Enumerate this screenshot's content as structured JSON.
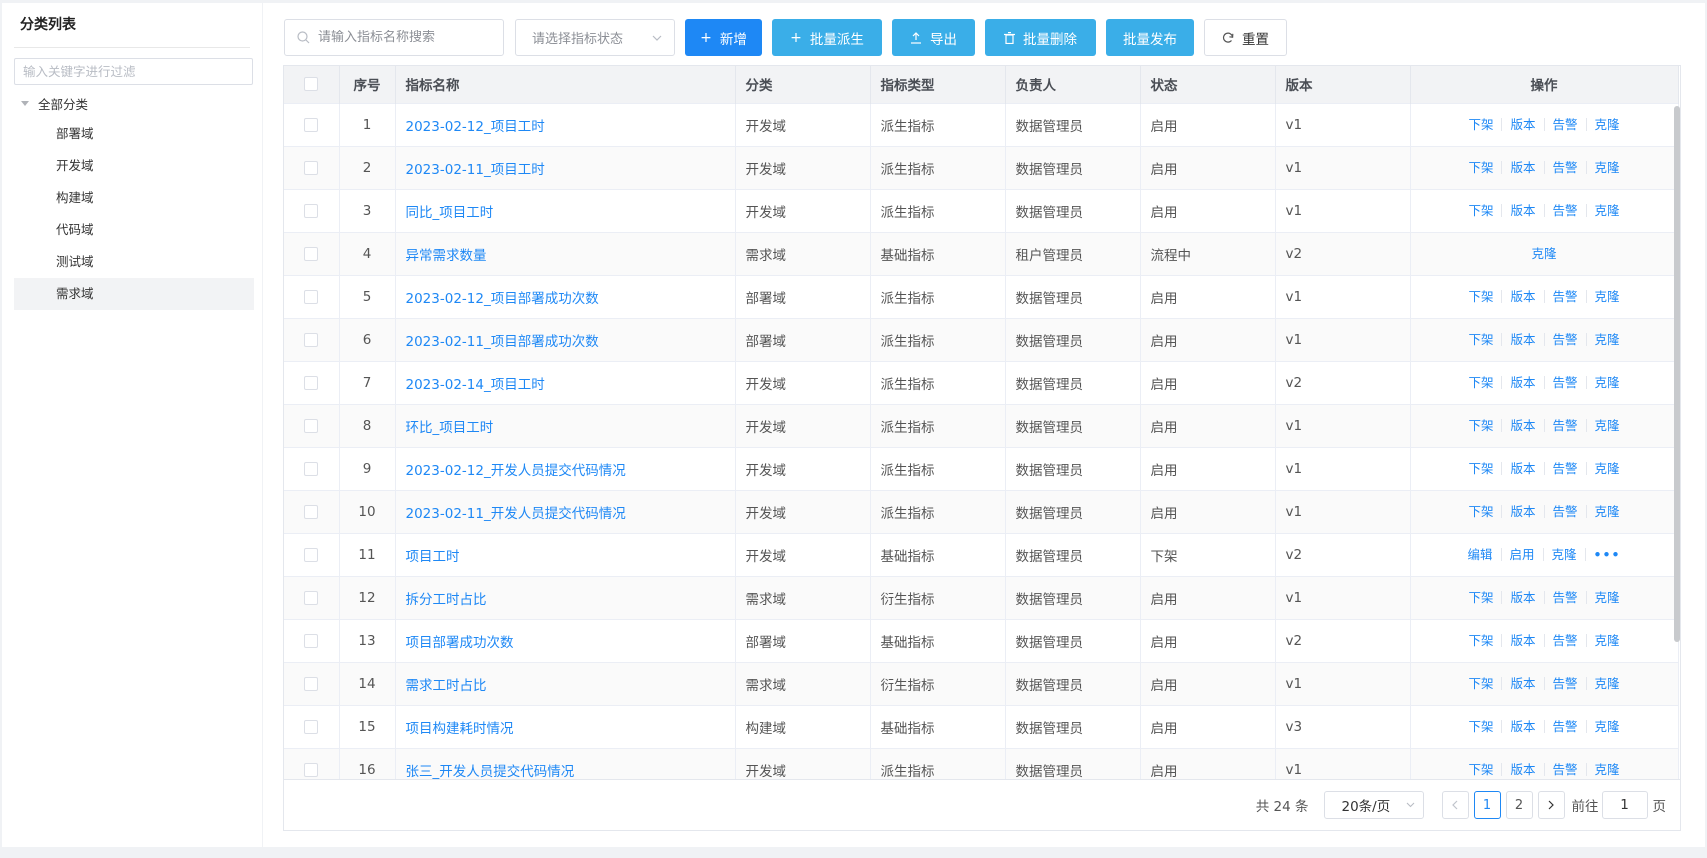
{
  "sidebar": {
    "title": "分类列表",
    "filter_placeholder": "输入关键字进行过滤",
    "root_label": "全部分类",
    "items": [
      {
        "label": "部署域"
      },
      {
        "label": "开发域"
      },
      {
        "label": "构建域"
      },
      {
        "label": "代码域"
      },
      {
        "label": "测试域"
      },
      {
        "label": "需求域"
      }
    ],
    "active_item": "需求域"
  },
  "toolbar": {
    "search_placeholder": "请输入指标名称搜索",
    "status_placeholder": "请选择指标状态",
    "add_label": "新增",
    "batch_derive_label": "批量派生",
    "export_label": "导出",
    "batch_delete_label": "批量删除",
    "batch_publish_label": "批量发布",
    "reset_label": "重置"
  },
  "table": {
    "columns": [
      "序号",
      "指标名称",
      "分类",
      "指标类型",
      "负责人",
      "状态",
      "版本",
      "操作"
    ],
    "rows": [
      {
        "no": "1",
        "name": "2023-02-12_项目工时",
        "category": "开发域",
        "type": "派生指标",
        "owner": "数据管理员",
        "status": "启用",
        "version": "v1",
        "ops": [
          "下架",
          "版本",
          "告警",
          "克隆"
        ]
      },
      {
        "no": "2",
        "name": "2023-02-11_项目工时",
        "category": "开发域",
        "type": "派生指标",
        "owner": "数据管理员",
        "status": "启用",
        "version": "v1",
        "ops": [
          "下架",
          "版本",
          "告警",
          "克隆"
        ]
      },
      {
        "no": "3",
        "name": "同比_项目工时",
        "category": "开发域",
        "type": "派生指标",
        "owner": "数据管理员",
        "status": "启用",
        "version": "v1",
        "ops": [
          "下架",
          "版本",
          "告警",
          "克隆"
        ]
      },
      {
        "no": "4",
        "name": "异常需求数量",
        "category": "需求域",
        "type": "基础指标",
        "owner": "租户管理员",
        "status": "流程中",
        "version": "v2",
        "ops": [
          "克隆"
        ]
      },
      {
        "no": "5",
        "name": "2023-02-12_项目部署成功次数",
        "category": "部署域",
        "type": "派生指标",
        "owner": "数据管理员",
        "status": "启用",
        "version": "v1",
        "ops": [
          "下架",
          "版本",
          "告警",
          "克隆"
        ]
      },
      {
        "no": "6",
        "name": "2023-02-11_项目部署成功次数",
        "category": "部署域",
        "type": "派生指标",
        "owner": "数据管理员",
        "status": "启用",
        "version": "v1",
        "ops": [
          "下架",
          "版本",
          "告警",
          "克隆"
        ]
      },
      {
        "no": "7",
        "name": "2023-02-14_项目工时",
        "category": "开发域",
        "type": "派生指标",
        "owner": "数据管理员",
        "status": "启用",
        "version": "v2",
        "ops": [
          "下架",
          "版本",
          "告警",
          "克隆"
        ]
      },
      {
        "no": "8",
        "name": "环比_项目工时",
        "category": "开发域",
        "type": "派生指标",
        "owner": "数据管理员",
        "status": "启用",
        "version": "v1",
        "ops": [
          "下架",
          "版本",
          "告警",
          "克隆"
        ]
      },
      {
        "no": "9",
        "name": "2023-02-12_开发人员提交代码情况",
        "category": "开发域",
        "type": "派生指标",
        "owner": "数据管理员",
        "status": "启用",
        "version": "v1",
        "ops": [
          "下架",
          "版本",
          "告警",
          "克隆"
        ]
      },
      {
        "no": "10",
        "name": "2023-02-11_开发人员提交代码情况",
        "category": "开发域",
        "type": "派生指标",
        "owner": "数据管理员",
        "status": "启用",
        "version": "v1",
        "ops": [
          "下架",
          "版本",
          "告警",
          "克隆"
        ]
      },
      {
        "no": "11",
        "name": "项目工时",
        "category": "开发域",
        "type": "基础指标",
        "owner": "数据管理员",
        "status": "下架",
        "version": "v2",
        "ops": [
          "编辑",
          "启用",
          "克隆",
          "•••"
        ]
      },
      {
        "no": "12",
        "name": "拆分工时占比",
        "category": "需求域",
        "type": "衍生指标",
        "owner": "数据管理员",
        "status": "启用",
        "version": "v1",
        "ops": [
          "下架",
          "版本",
          "告警",
          "克隆"
        ]
      },
      {
        "no": "13",
        "name": "项目部署成功次数",
        "category": "部署域",
        "type": "基础指标",
        "owner": "数据管理员",
        "status": "启用",
        "version": "v2",
        "ops": [
          "下架",
          "版本",
          "告警",
          "克隆"
        ]
      },
      {
        "no": "14",
        "name": "需求工时占比",
        "category": "需求域",
        "type": "衍生指标",
        "owner": "数据管理员",
        "status": "启用",
        "version": "v1",
        "ops": [
          "下架",
          "版本",
          "告警",
          "克隆"
        ]
      },
      {
        "no": "15",
        "name": "项目构建耗时情况",
        "category": "构建域",
        "type": "基础指标",
        "owner": "数据管理员",
        "status": "启用",
        "version": "v3",
        "ops": [
          "下架",
          "版本",
          "告警",
          "克隆"
        ]
      },
      {
        "no": "16",
        "name": "张三_开发人员提交代码情况",
        "category": "开发域",
        "type": "派生指标",
        "owner": "数据管理员",
        "status": "启用",
        "version": "v1",
        "ops": [
          "下架",
          "版本",
          "告警",
          "克隆"
        ]
      }
    ]
  },
  "pagination": {
    "total_text": "共 24 条",
    "page_size": "20条/页",
    "pages": [
      "1",
      "2"
    ],
    "current_page": "1",
    "goto_label": "前往",
    "goto_value": "1",
    "page_suffix": "页"
  },
  "colors": {
    "primary": "#1e88f5",
    "info": "#3aaee8"
  }
}
